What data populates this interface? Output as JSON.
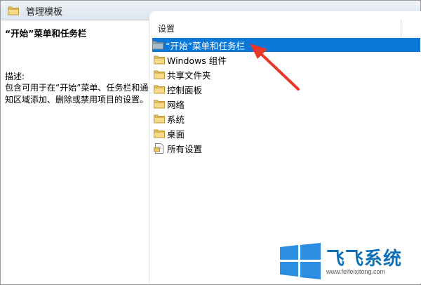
{
  "window": {
    "title": "管理模板"
  },
  "left_panel": {
    "name": "“开始”菜单和任务栏",
    "desc_label": "描述:",
    "desc": "包含可用于在“开始”菜单、任务栏和通知区域添加、删除或禁用项目的设置。"
  },
  "right_panel": {
    "column_header": "设置",
    "items": [
      {
        "label": "“开始”菜单和任务栏",
        "icon": "folder-icon",
        "selected": true
      },
      {
        "label": "Windows 组件",
        "icon": "folder-icon",
        "selected": false
      },
      {
        "label": "共享文件夹",
        "icon": "folder-icon",
        "selected": false
      },
      {
        "label": "控制面板",
        "icon": "folder-icon",
        "selected": false
      },
      {
        "label": "网络",
        "icon": "folder-icon",
        "selected": false
      },
      {
        "label": "系统",
        "icon": "folder-icon",
        "selected": false
      },
      {
        "label": "桌面",
        "icon": "folder-icon",
        "selected": false
      },
      {
        "label": "所有设置",
        "icon": "settings-page-icon",
        "selected": false
      }
    ]
  },
  "watermark": {
    "brand": "飞飞系统",
    "url": "www.feifeixitong.com"
  },
  "colors": {
    "selection": "#0b78d7",
    "arrow": "#e8382a",
    "brand": "#0d6fb8"
  }
}
